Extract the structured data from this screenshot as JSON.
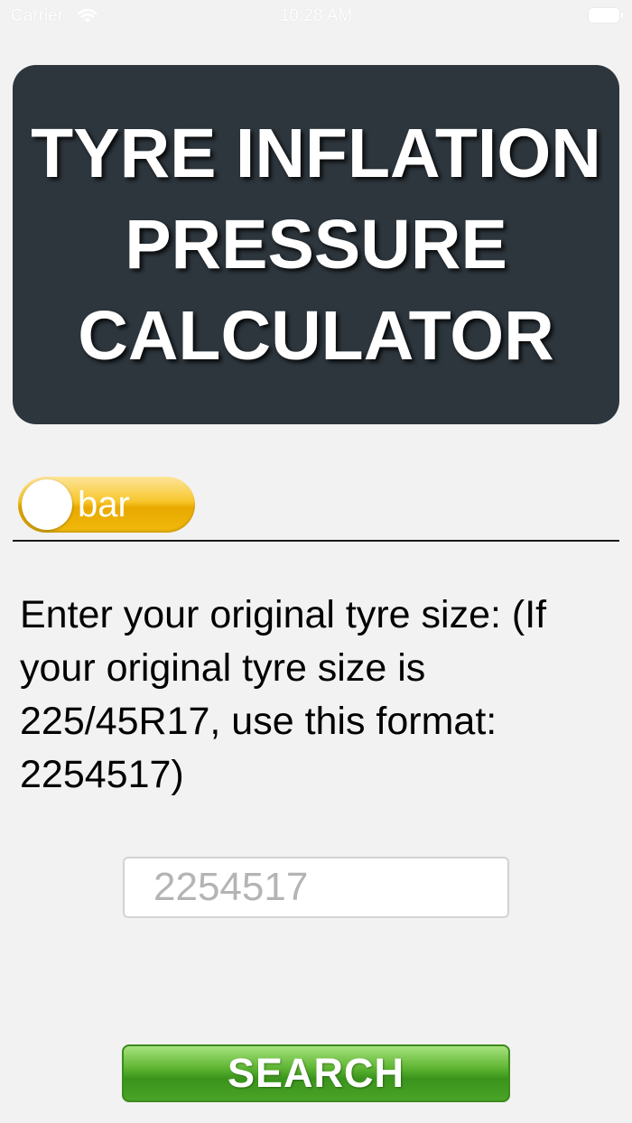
{
  "status_bar": {
    "carrier": "Carrier",
    "time": "10:28 AM"
  },
  "header": {
    "title": "TYRE INFLATION PRESSURE CALCULATOR"
  },
  "unit_toggle": {
    "label": "bar",
    "accent_color": "#f1b90c"
  },
  "form": {
    "instructions": "Enter your original tyre size: (If your original tyre size is 225/45R17, use this format: 2254517)",
    "tyre_size_value": "",
    "tyre_size_placeholder": "2254517"
  },
  "search_button": {
    "label": "SEARCH",
    "color": "#4aa326"
  },
  "icons": {
    "wifi": "wifi-icon",
    "battery": "battery-icon"
  }
}
